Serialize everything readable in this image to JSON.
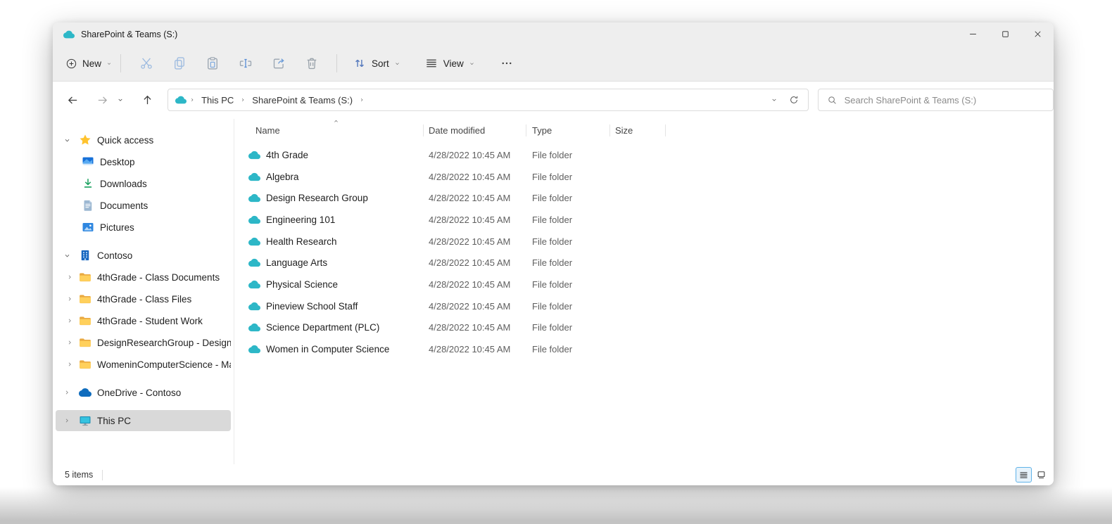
{
  "window": {
    "title": "SharePoint & Teams (S:)"
  },
  "toolbar": {
    "new_label": "New",
    "sort_label": "Sort",
    "view_label": "View"
  },
  "navbar": {
    "breadcrumb": {
      "items": [
        "This PC",
        "SharePoint & Teams (S:)"
      ]
    },
    "search_placeholder": "Search SharePoint & Teams (S:)"
  },
  "sidebar": {
    "quick_access": {
      "label": "Quick access",
      "items": [
        "Desktop",
        "Downloads",
        "Documents",
        "Pictures"
      ]
    },
    "contoso": {
      "label": "Contoso",
      "items": [
        "4thGrade - Class Documents",
        "4thGrade - Class Files",
        "4thGrade - Student Work",
        "DesignResearchGroup - Design Resea",
        "WomeninComputerScience - Manage"
      ]
    },
    "onedrive": {
      "label": "OneDrive - Contoso"
    },
    "this_pc": {
      "label": "This PC"
    }
  },
  "file_list": {
    "columns": {
      "name": "Name",
      "date_modified": "Date modified",
      "type": "Type",
      "size": "Size"
    },
    "sort_column": "Name",
    "sort_direction": "ascending",
    "rows": [
      {
        "name": "4th Grade",
        "date_modified": "4/28/2022 10:45 AM",
        "type": "File folder",
        "size": ""
      },
      {
        "name": "Algebra",
        "date_modified": "4/28/2022 10:45 AM",
        "type": "File folder",
        "size": ""
      },
      {
        "name": "Design Research Group",
        "date_modified": "4/28/2022 10:45 AM",
        "type": "File folder",
        "size": ""
      },
      {
        "name": "Engineering 101",
        "date_modified": "4/28/2022 10:45 AM",
        "type": "File folder",
        "size": ""
      },
      {
        "name": "Health Research",
        "date_modified": "4/28/2022 10:45 AM",
        "type": "File folder",
        "size": ""
      },
      {
        "name": "Language Arts",
        "date_modified": "4/28/2022 10:45 AM",
        "type": "File folder",
        "size": ""
      },
      {
        "name": "Physical Science",
        "date_modified": "4/28/2022 10:45 AM",
        "type": "File folder",
        "size": ""
      },
      {
        "name": "Pineview School Staff",
        "date_modified": "4/28/2022 10:45 AM",
        "type": "File folder",
        "size": ""
      },
      {
        "name": "Science Department (PLC)",
        "date_modified": "4/28/2022 10:45 AM",
        "type": "File folder",
        "size": ""
      },
      {
        "name": "Women in Computer Science",
        "date_modified": "4/28/2022 10:45 AM",
        "type": "File folder",
        "size": ""
      }
    ]
  },
  "status_bar": {
    "items_count": "5 items"
  },
  "colors": {
    "accent_teal": "#2db7c7",
    "folder_yellow": "#ffd05c",
    "onedrive_blue": "#0f6cbd",
    "selection_gray": "#d9d9d9",
    "toggle_active_bg": "#e7f3fb",
    "toggle_active_border": "#5fb2e8",
    "chrome_gray": "#eeeeee"
  }
}
